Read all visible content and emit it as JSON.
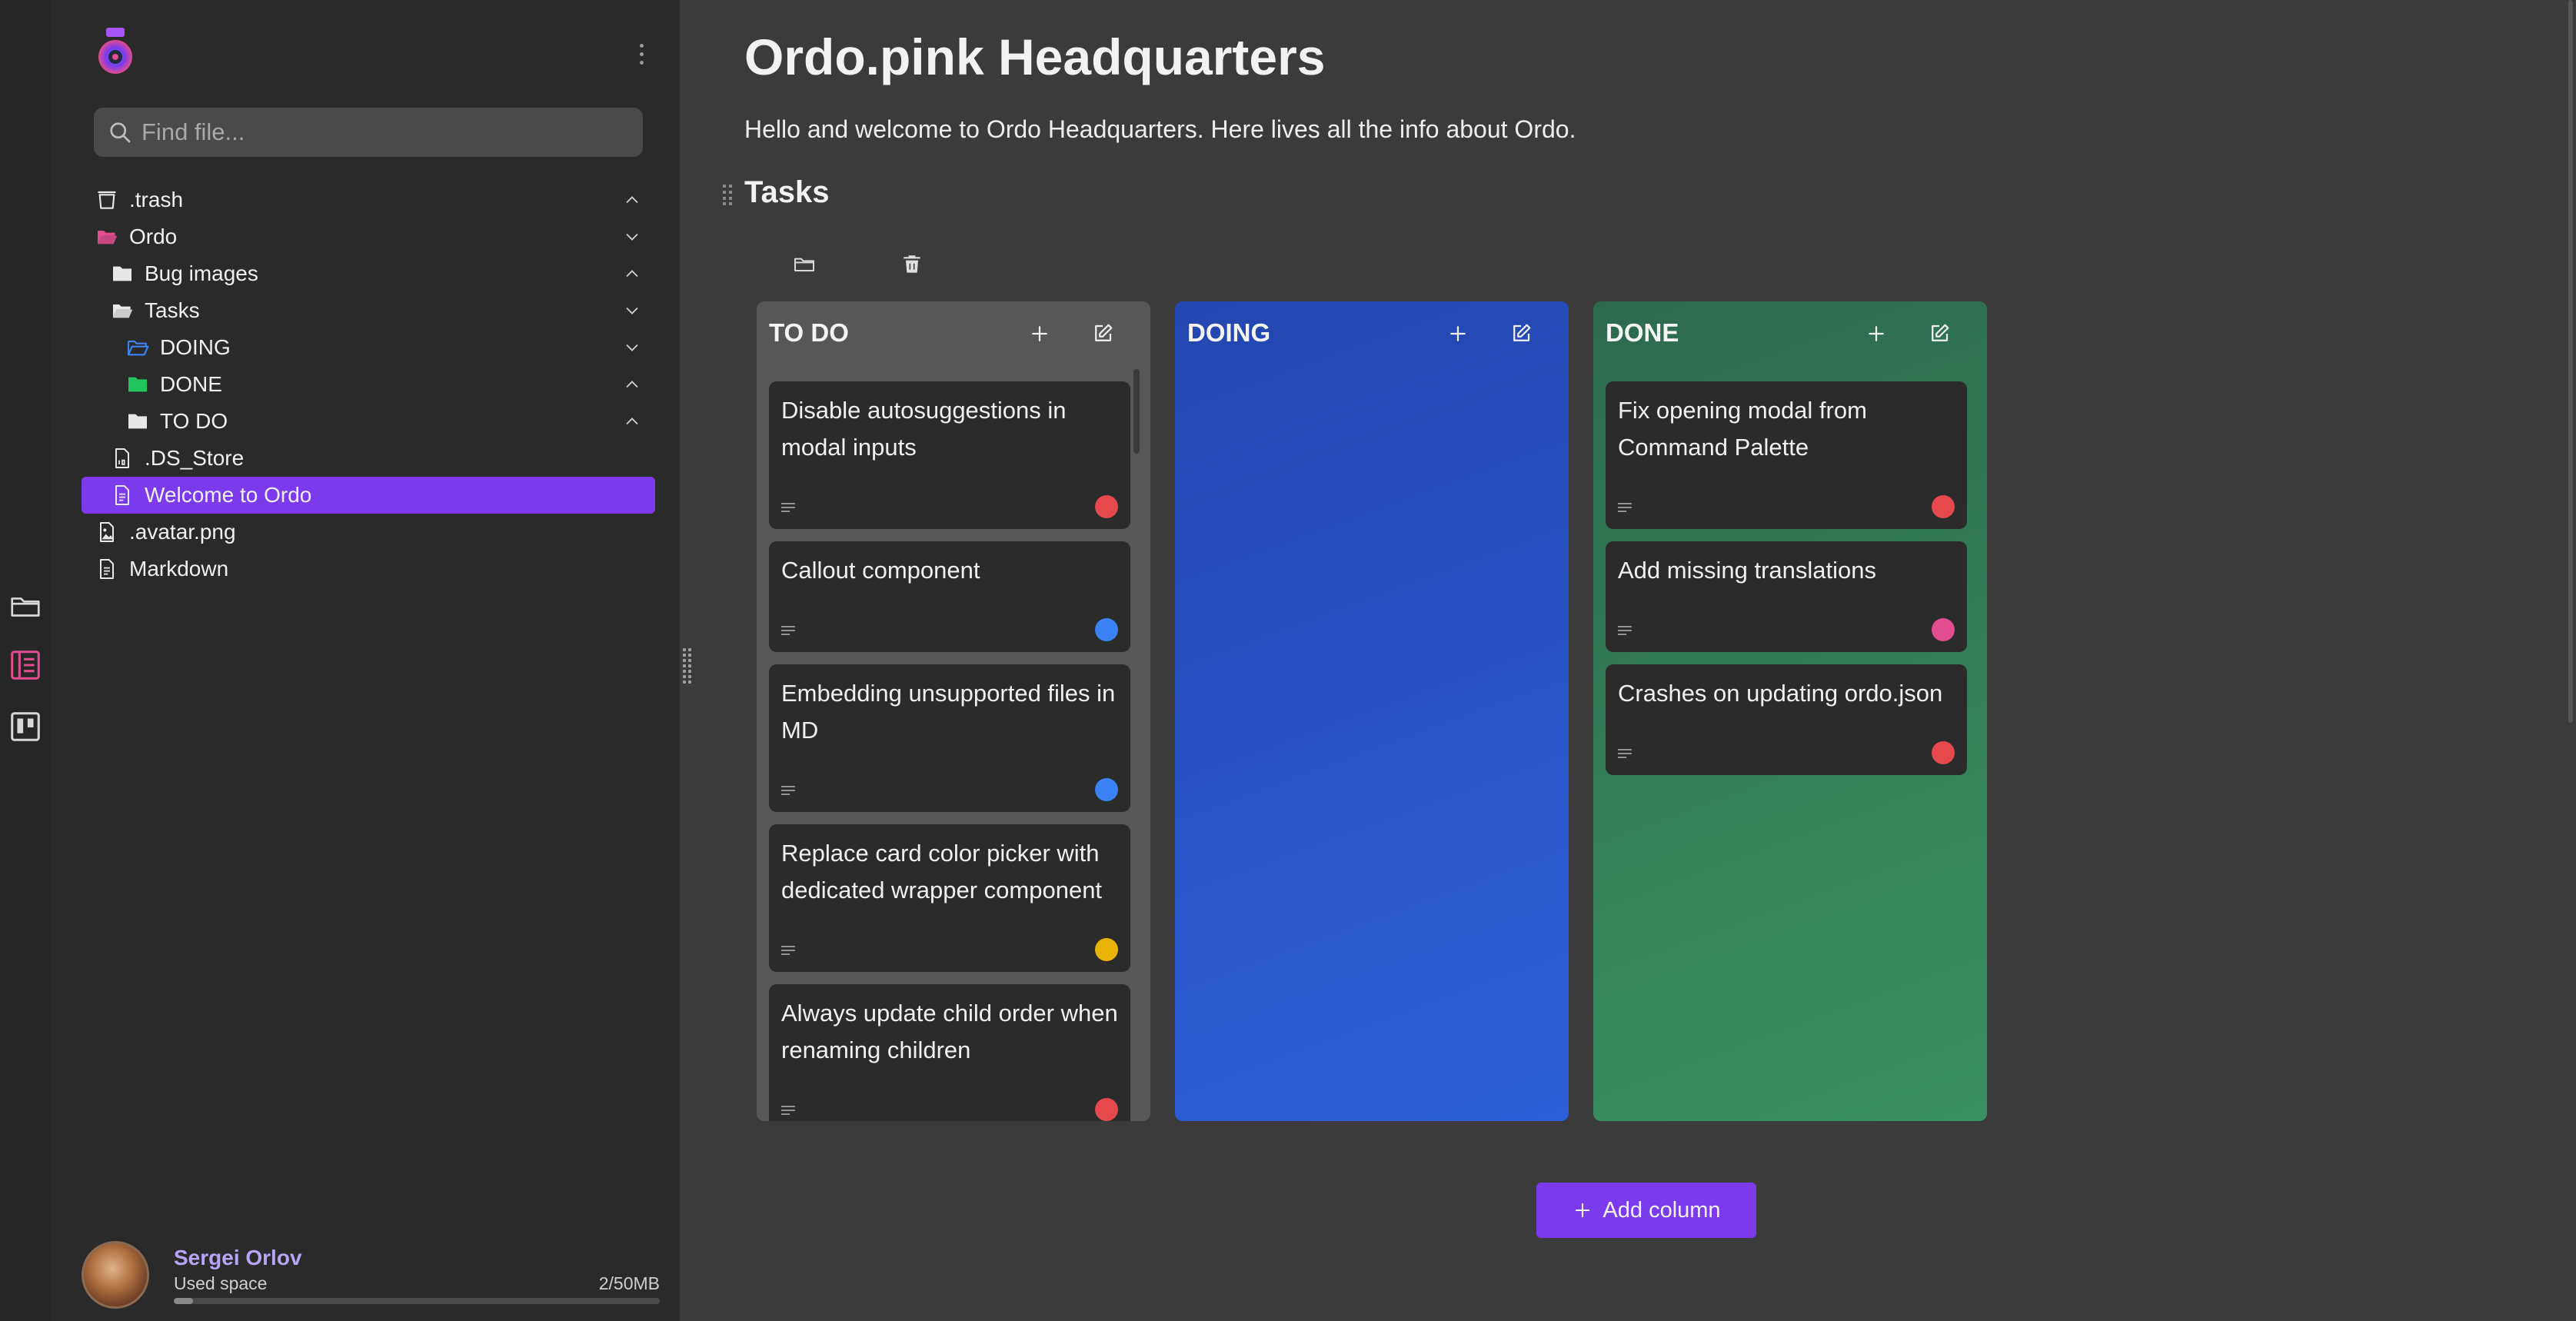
{
  "sidebar": {
    "search_placeholder": "Find file...",
    "tree": [
      {
        "label": ".trash",
        "icon": "trash-icon",
        "chevron": "up"
      },
      {
        "label": "Ordo",
        "icon": "folder-open-pink-icon",
        "chevron": "down"
      },
      {
        "label": "Bug images",
        "icon": "folder-icon",
        "chevron": "up"
      },
      {
        "label": "Tasks",
        "icon": "folder-open-icon",
        "chevron": "down"
      },
      {
        "label": "DOING",
        "icon": "folder-open-blue-icon",
        "chevron": "down"
      },
      {
        "label": "DONE",
        "icon": "folder-green-icon",
        "chevron": "up"
      },
      {
        "label": "TO DO",
        "icon": "folder-icon",
        "chevron": "up"
      },
      {
        "label": ".DS_Store",
        "icon": "binary-file-icon"
      },
      {
        "label": "Welcome to Ordo",
        "icon": "document-icon",
        "selected": true
      },
      {
        "label": ".avatar.png",
        "icon": "image-file-icon"
      },
      {
        "label": "Markdown",
        "icon": "document-icon"
      }
    ],
    "user": {
      "name": "Sergei Orlov",
      "used_label": "Used space",
      "used_value": "2/50MB",
      "used_fraction": 0.04
    }
  },
  "page": {
    "title": "Ordo.pink Headquarters",
    "description": "Hello and welcome to Ordo Headquarters. Here lives all the info about Ordo.",
    "section_title": "Tasks"
  },
  "board": {
    "columns": [
      {
        "title": "TO DO",
        "color": "#575757",
        "cards": [
          {
            "text": "Disable autosuggestions in modal inputs",
            "color": "#e5484d"
          },
          {
            "text": "Callout component",
            "color": "#3b82f6"
          },
          {
            "text": "Embedding unsupported files in MD",
            "color": "#3b82f6"
          },
          {
            "text": "Replace card color picker with dedicated wrapper component",
            "color": "#eab308"
          },
          {
            "text": "Always update child order when renaming children",
            "color": "#e5484d"
          }
        ]
      },
      {
        "title": "DOING",
        "color": "#2c5fd8",
        "cards": []
      },
      {
        "title": "DONE",
        "color": "#3a9062",
        "cards": [
          {
            "text": "Fix opening modal from Command Palette",
            "color": "#e5484d"
          },
          {
            "text": "Add missing translations",
            "color": "#e14d8f"
          },
          {
            "text": "Crashes on updating ordo.json",
            "color": "#e5484d"
          }
        ]
      }
    ],
    "add_column_label": "Add column"
  },
  "colors": {
    "accent": "#7c3aed",
    "sidebar_bg": "#2a2a2a",
    "main_bg": "#3b3b3b"
  }
}
